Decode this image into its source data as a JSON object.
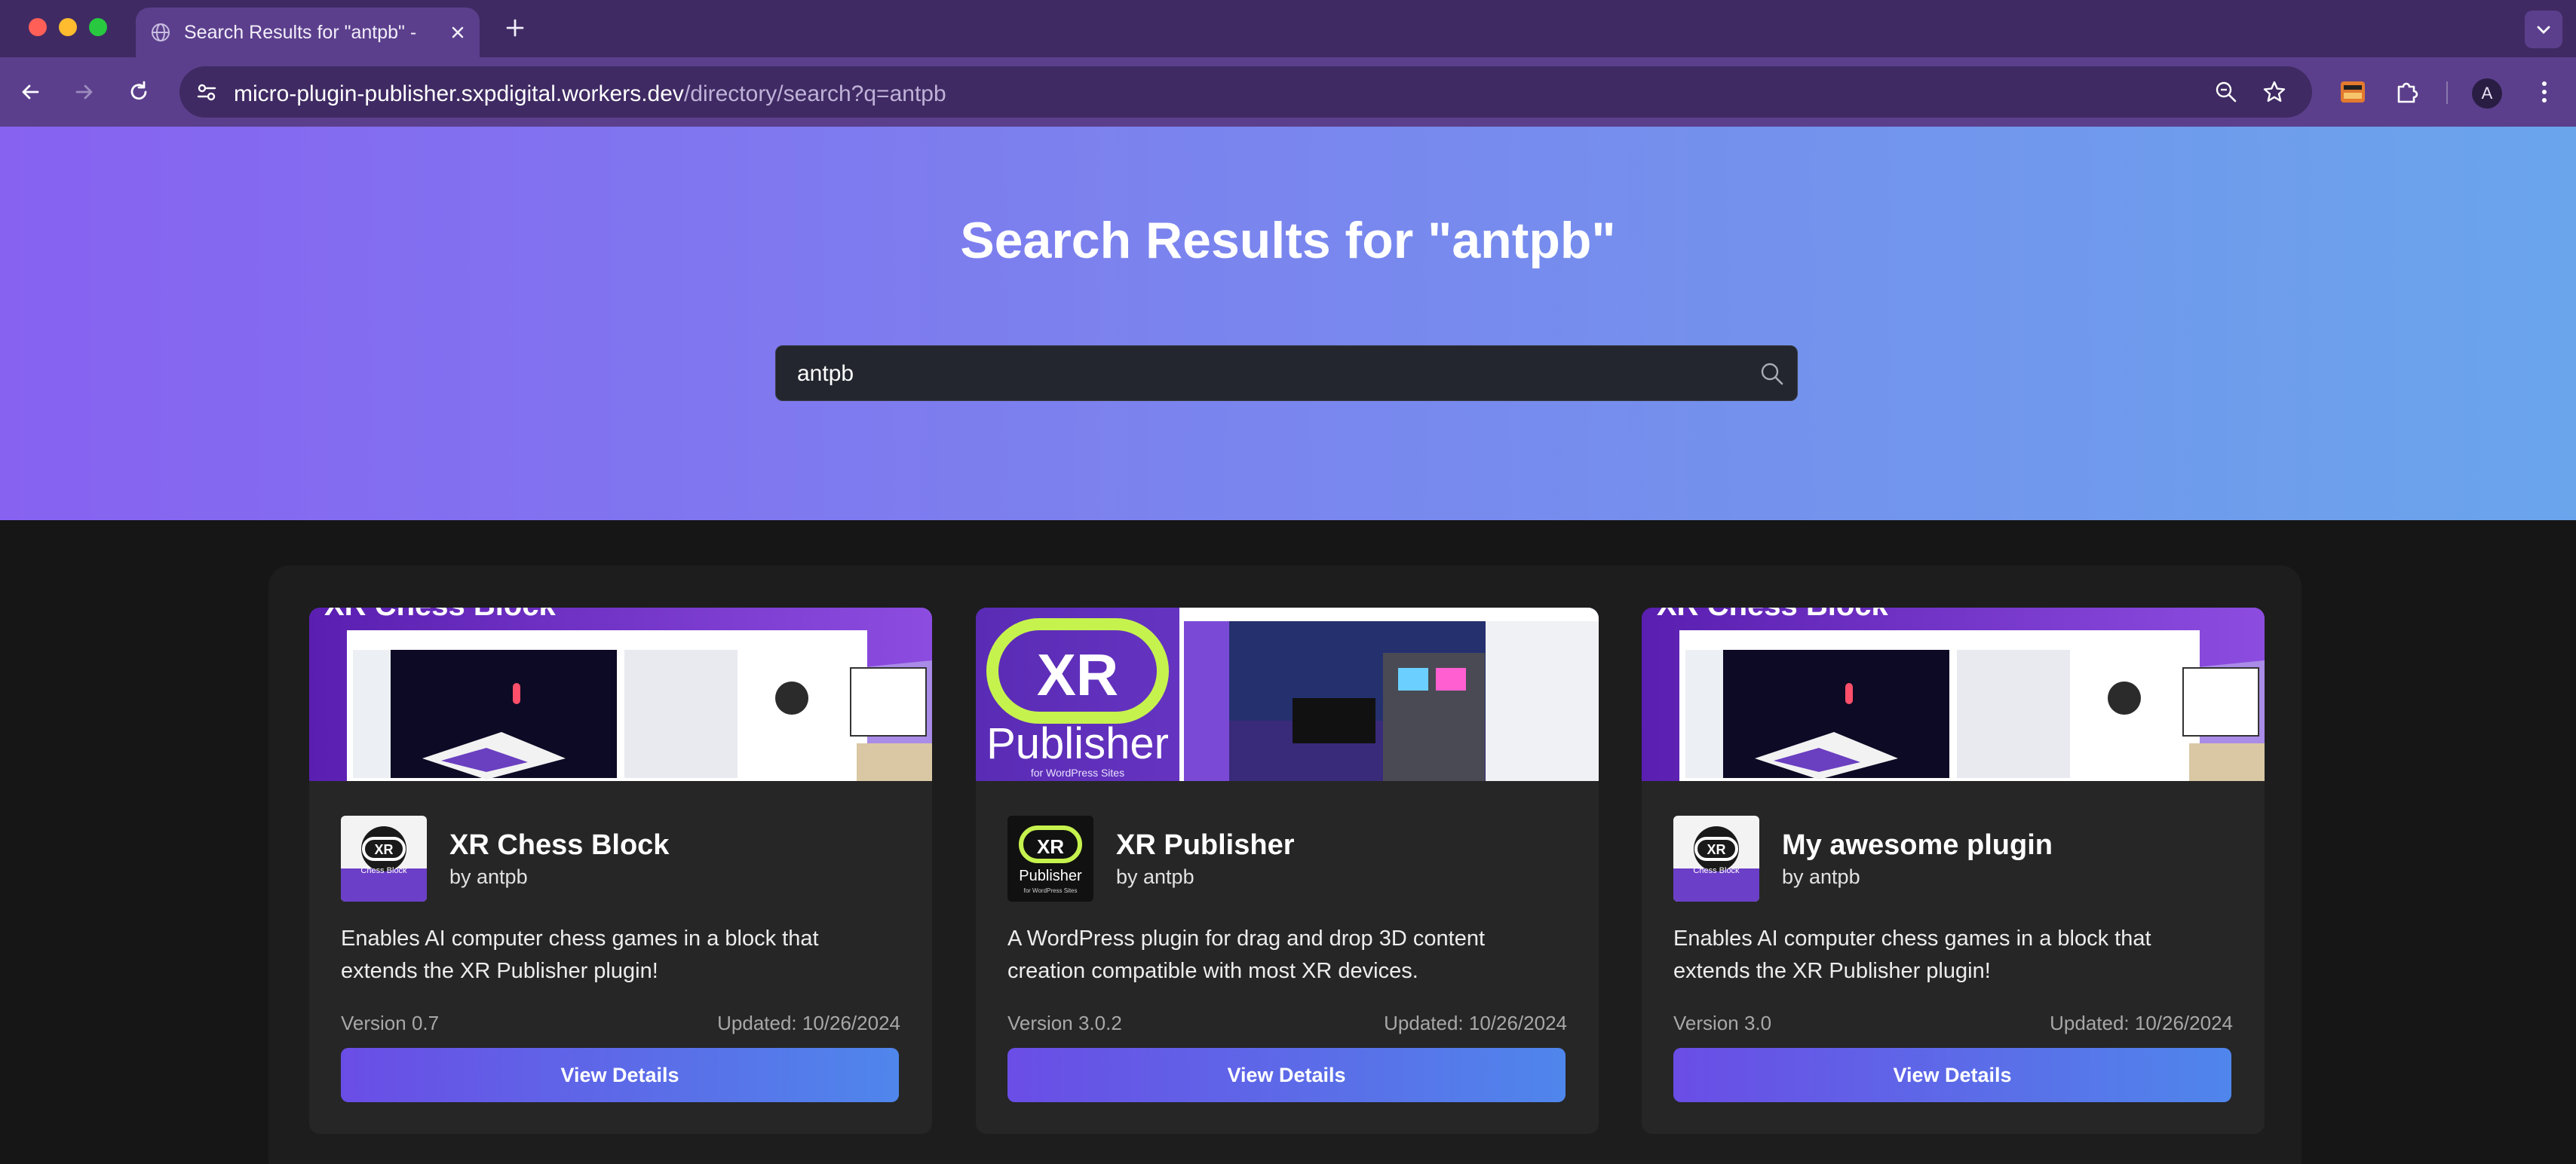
{
  "browser": {
    "tab_title": "Search Results for \"antpb\" - Micro Plugin Publisher",
    "new_tab_label": "+",
    "url_host": "micro-plugin-publisher.sxpdigital.workers.dev",
    "url_path": "/directory/search?q=antpb",
    "profile_initial": "A",
    "colors": {
      "tabbar": "#3f2a63",
      "toolbar": "#5b3f8c"
    }
  },
  "hero": {
    "title": "Search Results for \"antpb\"",
    "search_value": "antpb",
    "gradient": [
      "#8762f1",
      "#7b83ee",
      "#6aa5ec"
    ]
  },
  "results": [
    {
      "name": "XR Chess Block",
      "author": "by antpb",
      "description": "Enables AI computer chess games in a block that extends the XR Publisher plugin!",
      "version": "Version 0.7",
      "updated": "Updated: 10/26/2024",
      "button": "View Details",
      "banner": "chess-screenshot",
      "logo": "xr-chess-logo"
    },
    {
      "name": "XR Publisher",
      "author": "by antpb",
      "description": "A WordPress plugin for drag and drop 3D content creation compatible with most XR devices.",
      "version": "Version 3.0.2",
      "updated": "Updated: 10/26/2024",
      "button": "View Details",
      "banner": "xr-publisher-banner",
      "banner_text": {
        "logo": "XR",
        "title": "Publisher",
        "subtitle": "for WordPress Sites"
      },
      "logo": "xr-publisher-logo"
    },
    {
      "name": "My awesome plugin",
      "author": "by antpb",
      "description": "Enables AI computer chess games in a block that extends the XR Publisher plugin!",
      "version": "Version 3.0",
      "updated": "Updated: 10/26/2024",
      "button": "View Details",
      "banner": "chess-screenshot",
      "logo": "xr-chess-logo"
    }
  ],
  "accent": "#6a4de6"
}
